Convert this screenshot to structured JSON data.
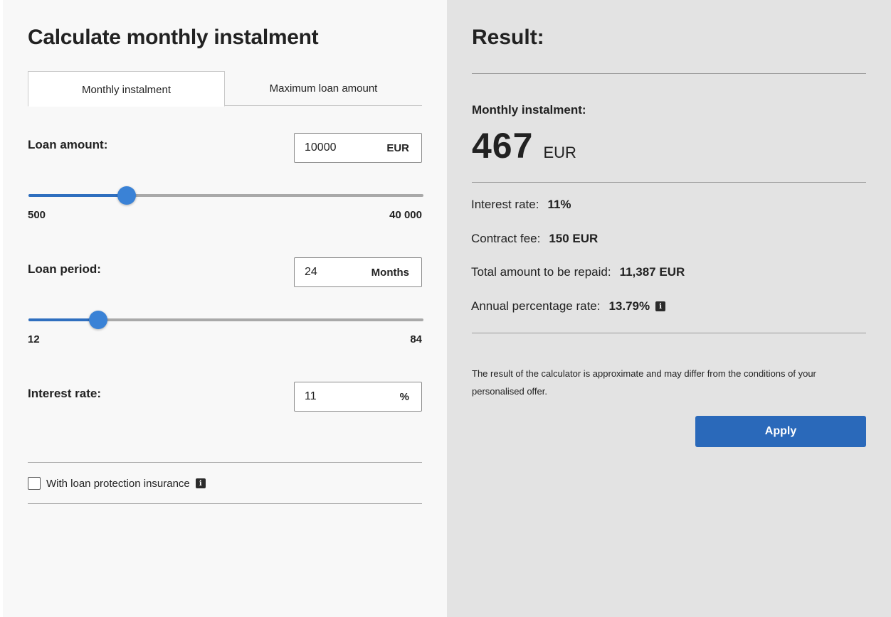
{
  "calculator": {
    "title": "Calculate monthly instalment",
    "tabs": [
      {
        "label": "Monthly instalment",
        "active": true
      },
      {
        "label": "Maximum loan amount",
        "active": false
      }
    ],
    "loan_amount": {
      "label": "Loan amount:",
      "value": "10000",
      "unit": "EUR",
      "min_label": "500",
      "max_label": "40 000",
      "min": 500,
      "max": 40000,
      "current": 10000
    },
    "loan_period": {
      "label": "Loan period:",
      "value": "24",
      "unit": "Months",
      "min_label": "12",
      "max_label": "84",
      "min": 12,
      "max": 84,
      "current": 24
    },
    "interest_rate": {
      "label": "Interest rate:",
      "value": "11",
      "unit": "%"
    },
    "insurance": {
      "label": "With loan protection insurance",
      "checked": false,
      "info_icon": "info-icon"
    }
  },
  "result": {
    "title": "Result:",
    "monthly_label": "Monthly instalment:",
    "monthly_value": "467",
    "monthly_unit": "EUR",
    "details": [
      {
        "label": "Interest rate:",
        "value": "11%"
      },
      {
        "label": "Contract fee:",
        "value": "150 EUR"
      },
      {
        "label": "Total amount to be repaid:",
        "value": "11,387 EUR"
      },
      {
        "label": "Annual percentage rate:",
        "value": "13.79%"
      }
    ],
    "disclaimer": "The result of the calculator is approximate and may differ from the conditions of your personalised offer.",
    "apply_label": "Apply"
  },
  "colors": {
    "accent": "#2a69ba",
    "slider_thumb": "#3a82d6",
    "left_bg": "#f8f8f8",
    "right_bg": "#e3e3e3"
  }
}
